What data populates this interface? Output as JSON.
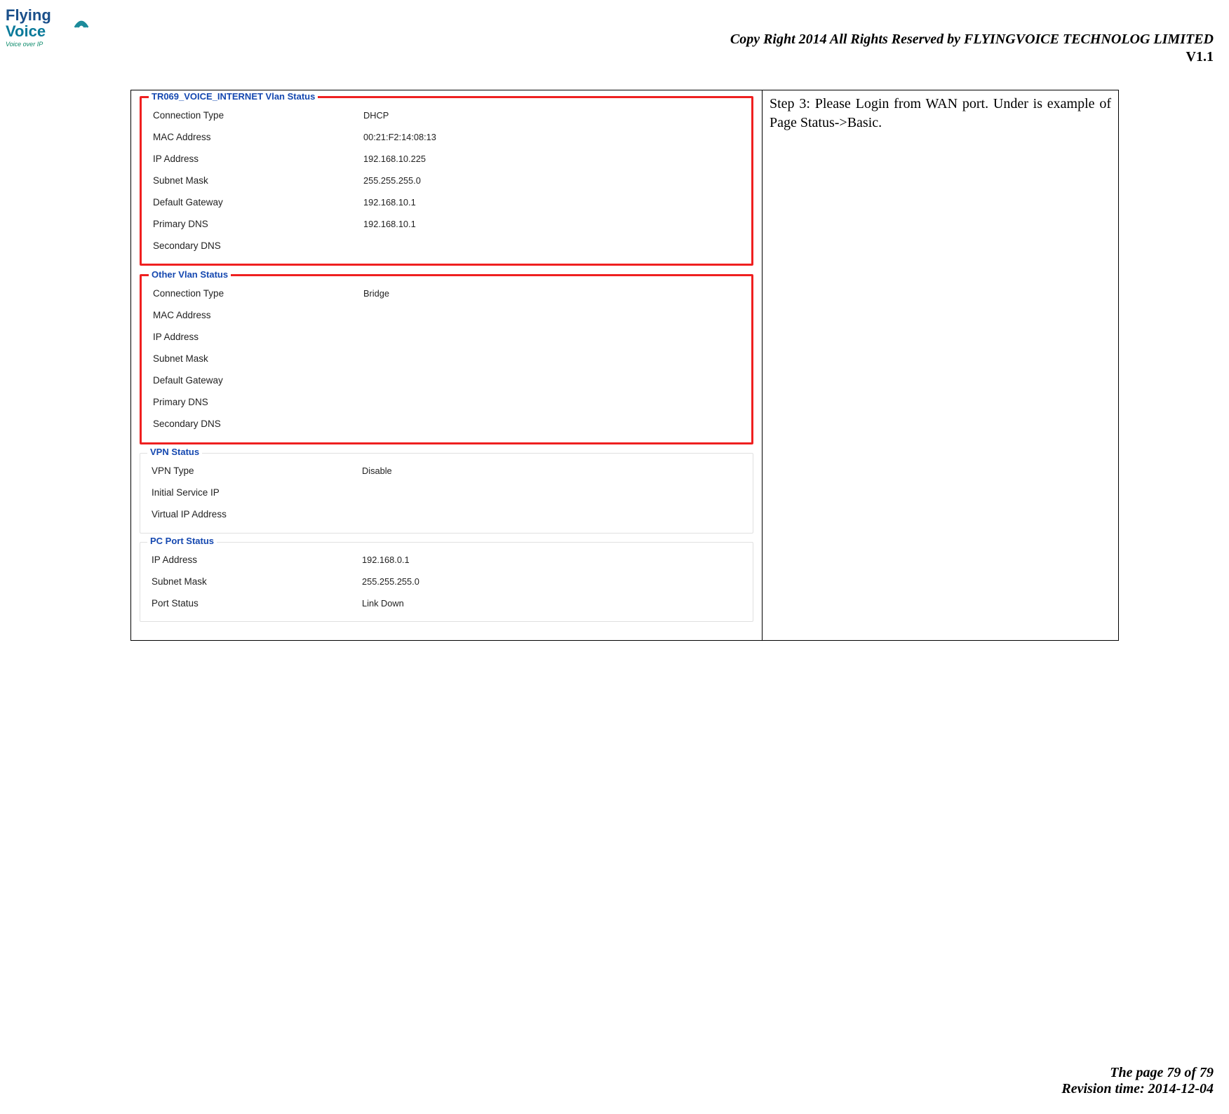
{
  "header": {
    "logo_top": "Flying",
    "logo_bottom": "Voice",
    "logo_tagline": "Voice over IP",
    "copyright": "Copy Right 2014 All Rights Reserved by FLYINGVOICE TECHNOLOG LIMITED",
    "version": "V1.1"
  },
  "instruction": "Step 3: Please Login from WAN port.  Under is example of Page Status->Basic.",
  "sections": [
    {
      "title": "TR069_VOICE_INTERNET Vlan Status",
      "highlighted": true,
      "rows": [
        {
          "label": "Connection Type",
          "value": "DHCP"
        },
        {
          "label": "MAC Address",
          "value": "00:21:F2:14:08:13"
        },
        {
          "label": "IP Address",
          "value": "192.168.10.225"
        },
        {
          "label": "Subnet Mask",
          "value": "255.255.255.0"
        },
        {
          "label": "Default Gateway",
          "value": "192.168.10.1"
        },
        {
          "label": "Primary DNS",
          "value": "192.168.10.1"
        },
        {
          "label": "Secondary DNS",
          "value": ""
        }
      ]
    },
    {
      "title": "Other Vlan Status",
      "highlighted": true,
      "rows": [
        {
          "label": "Connection Type",
          "value": "Bridge"
        },
        {
          "label": "MAC Address",
          "value": ""
        },
        {
          "label": "IP Address",
          "value": ""
        },
        {
          "label": "Subnet Mask",
          "value": ""
        },
        {
          "label": "Default Gateway",
          "value": ""
        },
        {
          "label": "Primary DNS",
          "value": ""
        },
        {
          "label": "Secondary DNS",
          "value": ""
        }
      ]
    },
    {
      "title": "VPN Status",
      "highlighted": false,
      "rows": [
        {
          "label": "VPN Type",
          "value": "Disable"
        },
        {
          "label": "Initial Service IP",
          "value": ""
        },
        {
          "label": "Virtual IP Address",
          "value": ""
        }
      ]
    },
    {
      "title": "PC Port Status",
      "highlighted": false,
      "rows": [
        {
          "label": "IP Address",
          "value": "192.168.0.1"
        },
        {
          "label": "Subnet Mask",
          "value": "255.255.255.0"
        },
        {
          "label": "Port Status",
          "value": "Link Down"
        }
      ]
    }
  ],
  "footer": {
    "page": "The page 79 of 79",
    "revision": "Revision time: 2014-12-04"
  }
}
